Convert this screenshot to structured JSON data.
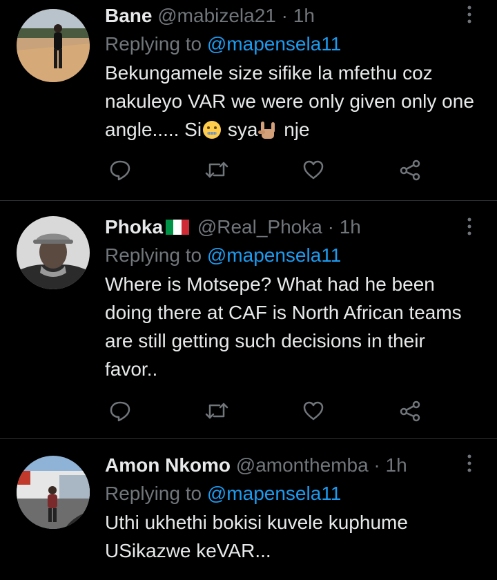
{
  "theme": {
    "background": "#000000",
    "text": "#e7e9ea",
    "muted": "#71767b",
    "link": "#1d9bf0",
    "divider": "#2f3336"
  },
  "tweets": [
    {
      "name": "Bane",
      "handle": "@mabizela21",
      "sep": "·",
      "time": "1h",
      "reply_prefix": "Replying to",
      "reply_to": "@mapensela11",
      "text_parts": [
        "Bekungamele size sifike la mfethu coz nakuleyo VAR we were only given only one angle..... Si",
        "sya",
        "nje"
      ],
      "emojis": [
        "zipper-mouth-face-emoji",
        "love-you-gesture-emoji"
      ],
      "avatar": "avatar-person-walking"
    },
    {
      "name": "Phoka",
      "flag": "italy-flag",
      "handle": "@Real_Phoka",
      "sep": "·",
      "time": "1h",
      "reply_prefix": "Replying to",
      "reply_to": "@mapensela11",
      "text": "Where is Motsepe? What had he been doing there at CAF is North African teams are still getting such decisions in their favor..",
      "avatar": "avatar-man-with-hat"
    },
    {
      "name": "Amon Nkomo",
      "handle": "@amonthemba",
      "sep": "·",
      "time": "1h",
      "reply_prefix": "Replying to",
      "reply_to": "@mapensela11",
      "text": "Uthi ukhethi bokisi kuvele kuphume USikazwe keVAR...",
      "avatar": "avatar-street-scene"
    }
  ],
  "actions": [
    "reply-icon",
    "retweet-icon",
    "like-icon",
    "share-icon"
  ]
}
